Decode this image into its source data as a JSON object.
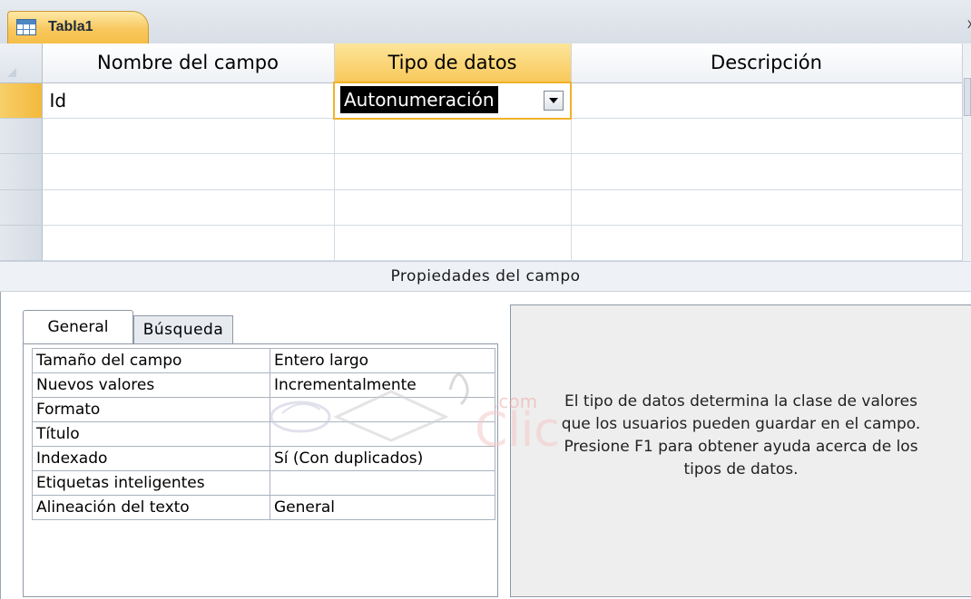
{
  "document_tab": {
    "title": "Tabla1",
    "icon": "table-icon",
    "close": "x"
  },
  "grid": {
    "columns": [
      "Nombre del campo",
      "Tipo de datos",
      "Descripción"
    ],
    "rows": [
      {
        "name": "Id",
        "type": "Autonumeración",
        "description": ""
      },
      {
        "name": "",
        "type": "",
        "description": ""
      },
      {
        "name": "",
        "type": "",
        "description": ""
      },
      {
        "name": "",
        "type": "",
        "description": ""
      },
      {
        "name": "",
        "type": "",
        "description": ""
      }
    ]
  },
  "properties_bar": {
    "title": "Propiedades del campo"
  },
  "properties": {
    "tabs": [
      "General",
      "Búsqueda"
    ],
    "active_tab": "General",
    "rows": [
      {
        "label": "Tamaño del campo",
        "value": "Entero largo"
      },
      {
        "label": "Nuevos valores",
        "value": "Incrementalmente"
      },
      {
        "label": "Formato",
        "value": ""
      },
      {
        "label": "Título",
        "value": ""
      },
      {
        "label": "Indexado",
        "value": "Sí (Con duplicados)"
      },
      {
        "label": "Etiquetas inteligentes",
        "value": ""
      },
      {
        "label": "Alineación del texto",
        "value": "General"
      }
    ]
  },
  "help": {
    "lines": [
      "El tipo de datos determina la clase de valores",
      "que los usuarios pueden guardar en el campo.",
      "Presione F1 para obtener ayuda acerca de los",
      "tipos de datos."
    ]
  },
  "watermark": {
    "text": "aulaclic .com"
  },
  "colors": {
    "accent": "#f8c95b",
    "selection_border": "#f0b22a",
    "frame": "#8e99a6"
  }
}
